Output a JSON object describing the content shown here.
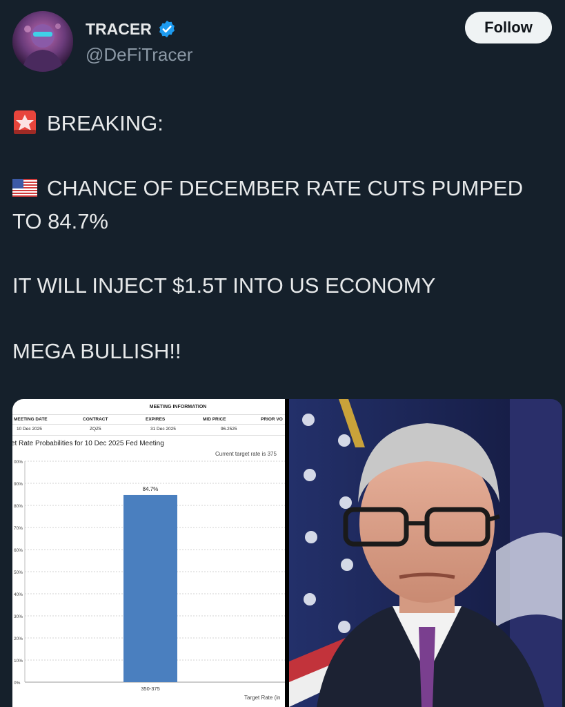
{
  "author": {
    "name": "TRACER",
    "handle": "@DeFiTracer",
    "verified_color": "#1d9bf0",
    "avatar_icon": "avatar-portrait"
  },
  "follow_button": {
    "label": "Follow"
  },
  "tweet": {
    "line1": "BREAKING:",
    "line2": "CHANCE OF DECEMBER RATE CUTS PUMPED",
    "line3": "TO 84.7%",
    "line4": "IT WILL INJECT $1.5T INTO US ECONOMY",
    "line5": "MEGA BULLISH!!",
    "emoji1": "siren-icon",
    "emoji2": "us-flag-icon"
  },
  "meeting_info": {
    "title": "MEETING INFORMATION",
    "headers": [
      "MEETING DATE",
      "CONTRACT",
      "EXPIRES",
      "MID PRICE",
      "PRIOR VO"
    ],
    "values": [
      "10 Dec 2025",
      "ZQZ5",
      "31 Dec 2025",
      "96.2525",
      ""
    ]
  },
  "chart_data": {
    "type": "bar",
    "title": "et Rate Probabilities for 10 Dec 2025 Fed Meeting",
    "subtitle": "Current target rate is 375",
    "categories": [
      "350-375"
    ],
    "values": [
      84.7
    ],
    "data_labels": [
      "84.7%"
    ],
    "xlabel": "Target Rate (in",
    "ylabel": "",
    "yticks": [
      "0%",
      "10%",
      "20%",
      "30%",
      "40%",
      "50%",
      "60%",
      "70%",
      "80%",
      "90%",
      "00%"
    ],
    "ylim": [
      0,
      100
    ],
    "grid": true,
    "bar_color": "#4a7fbf"
  }
}
